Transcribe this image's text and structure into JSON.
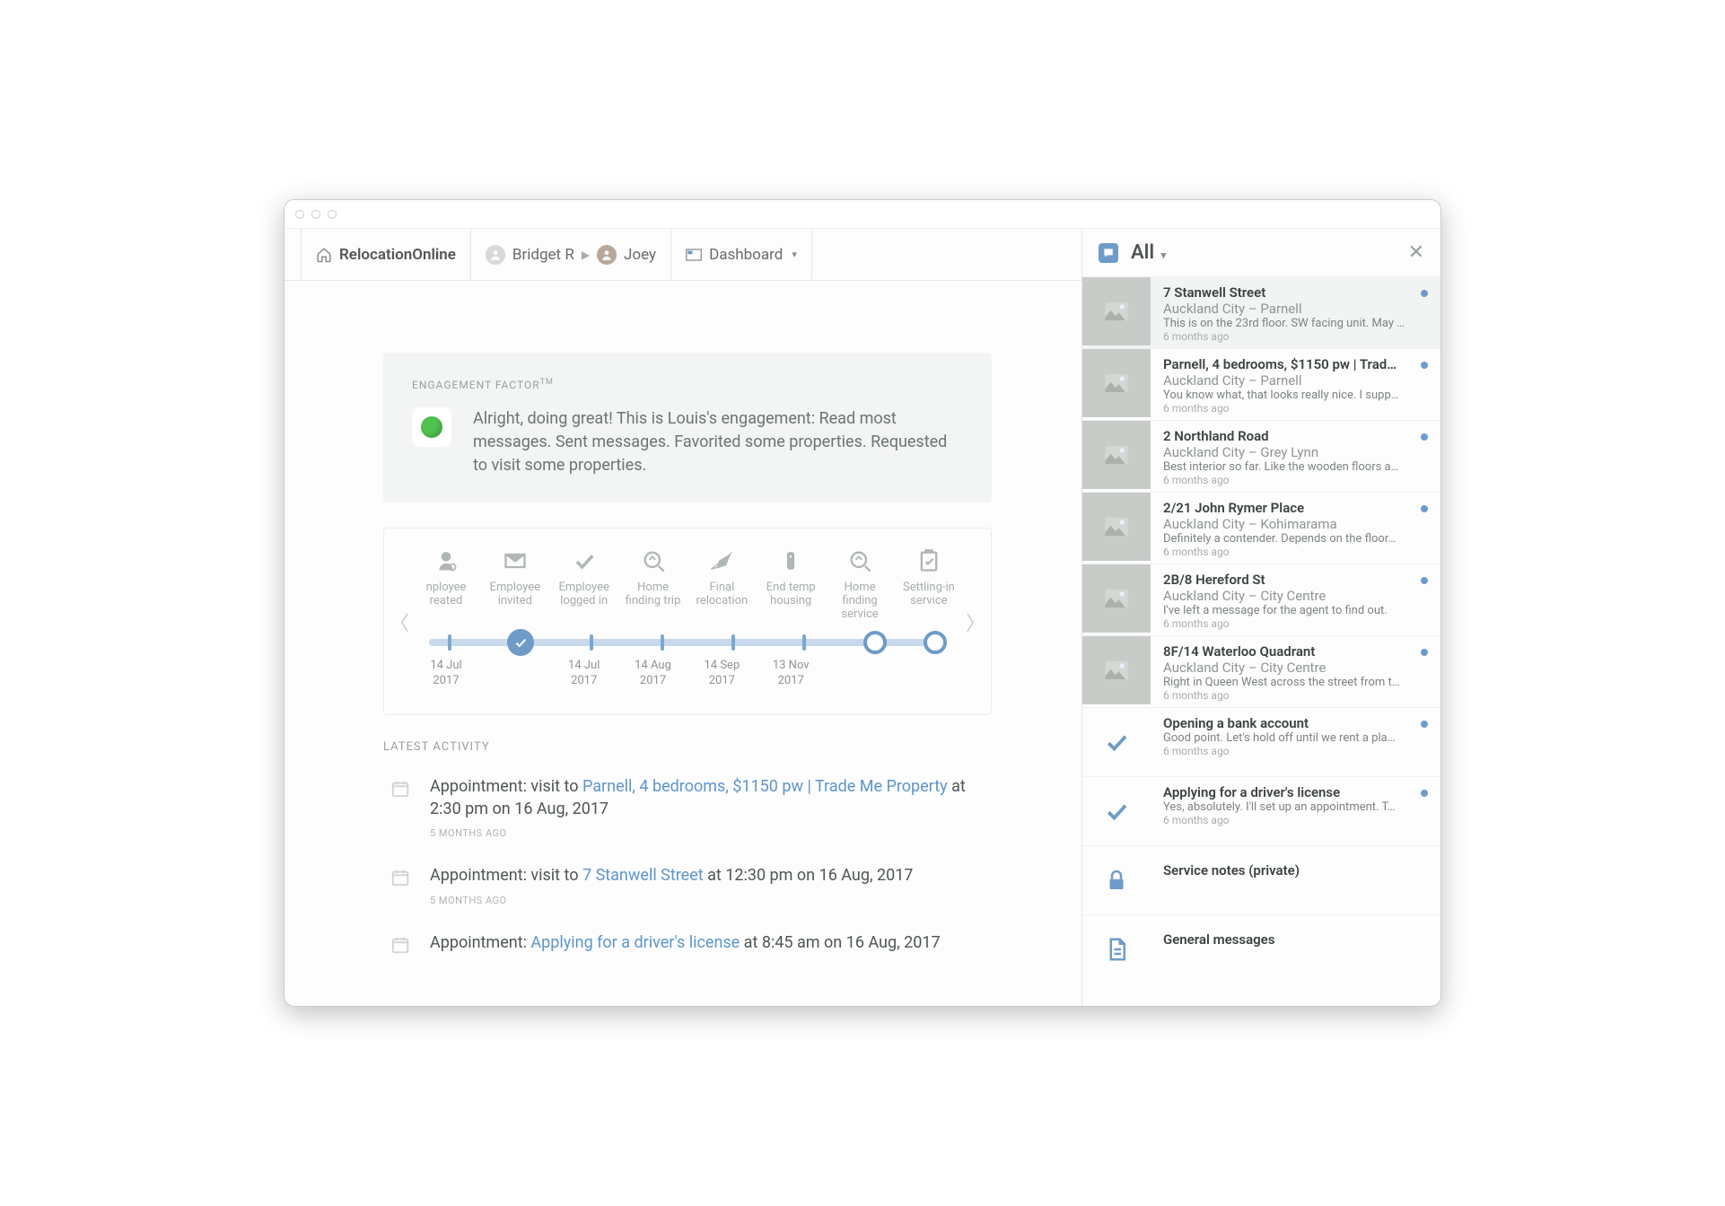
{
  "brand": "RelocationOnline",
  "nav": {
    "consultant": "Bridget R",
    "client": "Joey",
    "view": "Dashboard"
  },
  "engagement": {
    "label": "ENGAGEMENT FACTOR",
    "tm": "TM",
    "text": "Alright, doing great! This is Louis's engagement: Read most messages. Sent messages. Favorited some properties. Requested to visit some properties."
  },
  "timeline": {
    "items": [
      {
        "label": "nployee reated",
        "date": "14 Jul 2017"
      },
      {
        "label": "Employee invited",
        "date": ""
      },
      {
        "label": "Employee logged in",
        "date": "14 Jul 2017"
      },
      {
        "label": "Home finding trip",
        "date": "14 Aug 2017"
      },
      {
        "label": "Final relocation",
        "date": "14 Sep 2017"
      },
      {
        "label": "End temp housing",
        "date": "13 Nov 2017"
      },
      {
        "label": "Home finding service",
        "date": ""
      },
      {
        "label": "Settling-in service",
        "date": ""
      }
    ]
  },
  "latest_label": "LATEST ACTIVITY",
  "activity": [
    {
      "prefix": "Appointment: visit to ",
      "link": "Parnell, 4 bedrooms, $1150 pw | Trade Me Property",
      "suffix": " at 2:30 pm on 16 Aug, 2017",
      "time": "5 MONTHS AGO"
    },
    {
      "prefix": "Appointment: visit to ",
      "link": "7 Stanwell Street",
      "suffix": " at 12:30 pm on 16 Aug, 2017",
      "time": "5 MONTHS AGO"
    },
    {
      "prefix": "Appointment: ",
      "link": "Applying for a driver's license",
      "suffix": " at 8:45 am on 16 Aug, 2017",
      "time": ""
    }
  ],
  "panel": {
    "filter": "All",
    "items": [
      {
        "kind": "prop",
        "title": "7 Stanwell Street",
        "sub": "Auckland City – Parnell",
        "snip": "This is on the 23rd floor. SW facing unit. May …",
        "time": "6 months ago",
        "dot": true,
        "selected": true
      },
      {
        "kind": "prop",
        "title": "Parnell, 4 bedrooms, $1150 pw | Trad…",
        "sub": "Auckland City – Parnell",
        "snip": "You know what, that looks really nice. I supp…",
        "time": "6 months ago",
        "dot": true
      },
      {
        "kind": "prop",
        "title": "2 Northland Road",
        "sub": "Auckland City – Grey Lynn",
        "snip": "Best interior so far. Like the wooden floors a…",
        "time": "6 months ago",
        "dot": true
      },
      {
        "kind": "prop",
        "title": "2/21 John Rymer Place",
        "sub": "Auckland City – Kohimarama",
        "snip": "Definitely a contender. Depends on the floor…",
        "time": "6 months ago",
        "dot": true
      },
      {
        "kind": "prop",
        "title": "2B/8 Hereford St",
        "sub": "Auckland City – City Centre",
        "snip": "I've left a message for the agent to find out.",
        "time": "6 months ago",
        "dot": true
      },
      {
        "kind": "prop",
        "title": "8F/14 Waterloo Quadrant",
        "sub": "Auckland City – City Centre",
        "snip": "Right in Queen West across the street from t…",
        "time": "6 months ago",
        "dot": true
      },
      {
        "kind": "check",
        "title": "Opening a bank account",
        "sub": "",
        "snip": "Good point. Let's hold off until we rent a pla…",
        "time": "6 months ago",
        "dot": true
      },
      {
        "kind": "check",
        "title": "Applying for a driver's license",
        "sub": "",
        "snip": "Yes, absolutely. I'll set up an appointment. T…",
        "time": "6 months ago",
        "dot": true
      },
      {
        "kind": "lock",
        "title": "Service notes (private)",
        "sub": "",
        "snip": "",
        "time": "",
        "dot": false
      },
      {
        "kind": "doc",
        "title": "General messages",
        "sub": "",
        "snip": "",
        "time": "",
        "dot": false
      }
    ]
  }
}
